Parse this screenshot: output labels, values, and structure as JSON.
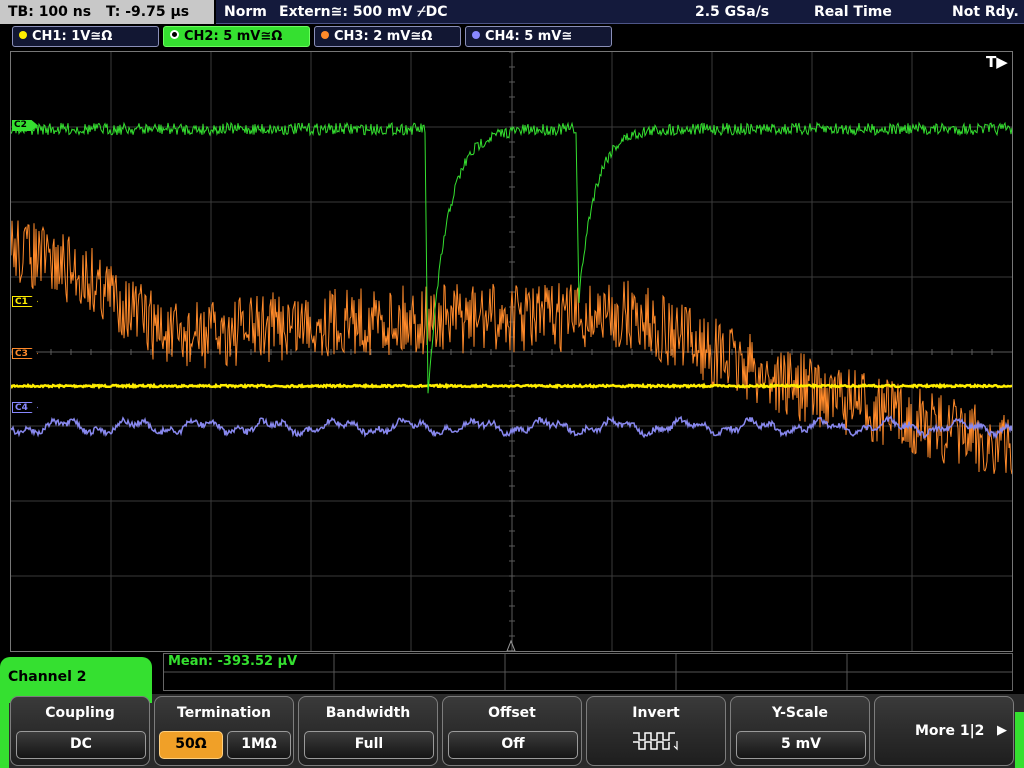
{
  "status": {
    "timebase": "TB: 100 ns",
    "trigger_time": "T: -9.75 µs",
    "trigger_mode": "Norm",
    "trigger_source": "Extern≅: 500 mV ⌿DC",
    "sample_rate": "2.5 GSa/s",
    "acq_mode": "Real Time",
    "state": "Not Rdy."
  },
  "channels": [
    {
      "label": "CH1: 1V≅Ω",
      "color": "#ffee00",
      "marker": "C1"
    },
    {
      "label": "CH2: 5 mV≅Ω",
      "color": "#35e030",
      "marker": "C2"
    },
    {
      "label": "CH3: 2 mV≅Ω",
      "color": "#ff8a2a",
      "marker": "C3"
    },
    {
      "label": "CH4: 5 mV≅",
      "color": "#8888ff",
      "marker": "C4"
    }
  ],
  "trigger_indicator": "T▶",
  "measurement": {
    "mean": "Mean: -393.52 µV"
  },
  "menu": {
    "title": "Channel 2",
    "coupling": {
      "title": "Coupling",
      "value": "DC"
    },
    "termination": {
      "title": "Termination",
      "opt1": "50Ω",
      "opt2": "1MΩ"
    },
    "bandwidth": {
      "title": "Bandwidth",
      "value": "Full"
    },
    "offset": {
      "title": "Offset",
      "value": "Off"
    },
    "invert": {
      "title": "Invert",
      "icon": "invert-waveform-icon"
    },
    "yscale": {
      "title": "Y-Scale",
      "value": "5 mV"
    },
    "more": {
      "label": "More 1|2",
      "icon": "right-arrow-icon"
    }
  }
}
